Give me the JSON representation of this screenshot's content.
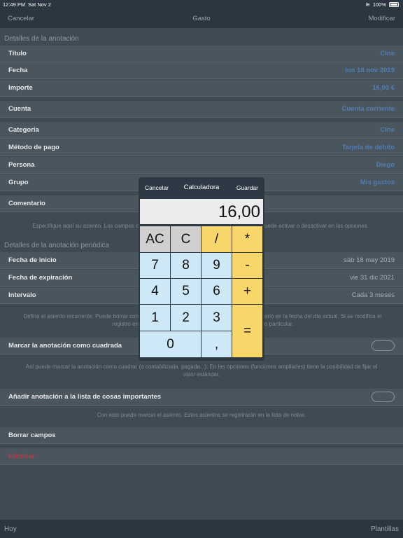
{
  "status": {
    "time": "12:49 PM",
    "date": "Sat Nov 2",
    "battery": "100%"
  },
  "nav": {
    "left": "Cancelar",
    "title": "Gasto",
    "right": "Modificar"
  },
  "sections": {
    "details": "Detalles de la anotación",
    "periodic": "Detalles de la anotación periódica"
  },
  "rows": {
    "titulo": {
      "label": "Título",
      "value": "Cine"
    },
    "fecha": {
      "label": "Fecha",
      "value": "lun 18 nov 2019"
    },
    "importe": {
      "label": "Importe",
      "value": "16,00 €"
    },
    "cuenta": {
      "label": "Cuenta",
      "value": "Cuenta corriente"
    },
    "categoria": {
      "label": "Categoría",
      "value": "Cine"
    },
    "metodo": {
      "label": "Método de pago",
      "value": "Tarjeta de débito"
    },
    "persona": {
      "label": "Persona",
      "value": "Diego"
    },
    "grupo": {
      "label": "Grupo",
      "value": "Mis gastos"
    },
    "comentario": {
      "label": "Comentario"
    },
    "inicio": {
      "label": "Fecha de inicio",
      "value": "sáb 18 may 2019"
    },
    "expiracion": {
      "label": "Fecha de expiración",
      "value": "vie 31 dic 2021"
    },
    "intervalo": {
      "label": "Intervalo",
      "value": "Cada 3 meses"
    },
    "cuadrada": {
      "label": "Marcar la anotación como cuadrada"
    },
    "importantes": {
      "label": "Añadir anotación a la lista de cosas importantes"
    },
    "borrar": {
      "label": "Borrar campos"
    },
    "eliminar": {
      "label": "Eliminar"
    }
  },
  "notes": {
    "comentario_a": "Especifique aquí su asiento. Los campos c",
    "comentario_b": "uede activar o desactivar en las opciones.",
    "periodic_1a": "Defina el asiento recurrente. Puede borrar con",
    "periodic_1b": "ario en la fecha del día actual. Si se modifica el",
    "periodic_2a": "registro en",
    "periodic_2b": "o particular.",
    "cuadrada": "Así puede marcar la anotación como cuadrar (o contabilizada, pagada...). En las opciones (funciones ampliadas) tiene la posibilidad de fijar el valor estándar.",
    "importantes": "Con esto puede marcar el asiento. Estos asientos se registrarán en la lista de notas."
  },
  "calculator": {
    "cancel": "Cancelar",
    "title": "Calculadora",
    "save": "Guardar",
    "display": "16,00",
    "keys": {
      "ac": "AC",
      "c": "C",
      "div": "/",
      "mul": "*",
      "k7": "7",
      "k8": "8",
      "k9": "9",
      "minus": "-",
      "k4": "4",
      "k5": "5",
      "k6": "6",
      "plus": "+",
      "k1": "1",
      "k2": "2",
      "k3": "3",
      "eq": "=",
      "k0": "0",
      "comma": ","
    }
  },
  "toolbar": {
    "left": "Hoy",
    "right": "Plantillas"
  }
}
